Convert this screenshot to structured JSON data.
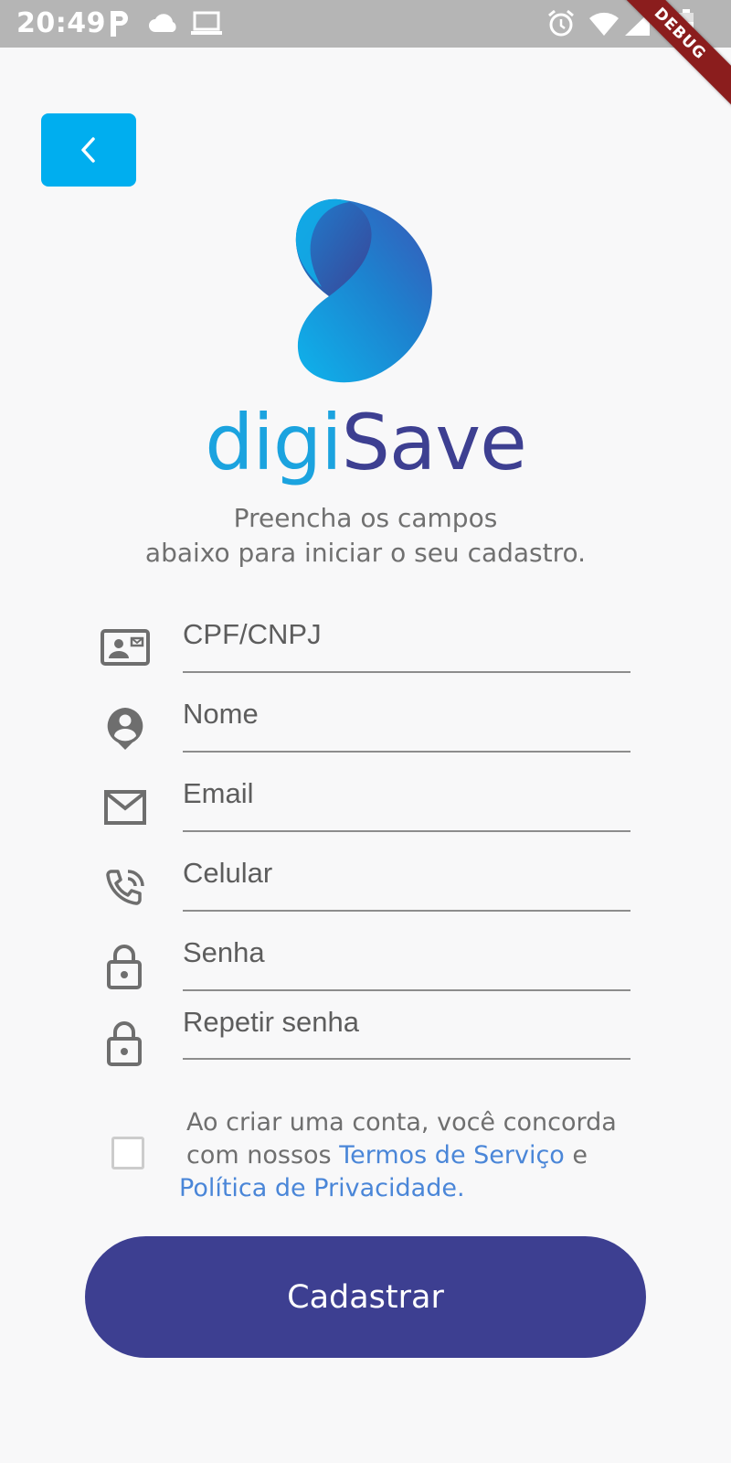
{
  "status_bar": {
    "time": "20:49",
    "icons": [
      "parking-icon",
      "cloud-icon",
      "laptop-icon",
      "alarm-icon",
      "wifi-icon",
      "signal-icon",
      "battery-icon"
    ],
    "debug_label": "DEBUG"
  },
  "header": {
    "back_icon": "chevron-left-icon"
  },
  "brand": {
    "logo_part1": "digi",
    "logo_part2": "Save",
    "color_primary": "#3d3f91",
    "color_accent": "#00aeef"
  },
  "subtitle": {
    "line1": "Preencha os campos",
    "line2": "abaixo para iniciar o seu cadastro."
  },
  "form": {
    "fields": [
      {
        "label": "CPF/CNPJ",
        "icon": "id-card-icon"
      },
      {
        "label": "Nome",
        "icon": "person-pin-icon"
      },
      {
        "label": "Email",
        "icon": "mail-icon"
      },
      {
        "label": "Celular",
        "icon": "phone-in-talk-icon"
      },
      {
        "label": "Senha",
        "icon": "lock-icon"
      },
      {
        "label": "Repetir senha",
        "icon": "lock-icon"
      }
    ]
  },
  "terms": {
    "line1": "Ao criar uma conta, você concorda",
    "line2_prefix": "com nossos ",
    "terms_link": "Termos de Serviço",
    "line2_suffix": " e",
    "privacy_link": "Política de Privacidade.",
    "checked": false
  },
  "submit": {
    "label": "Cadastrar"
  }
}
